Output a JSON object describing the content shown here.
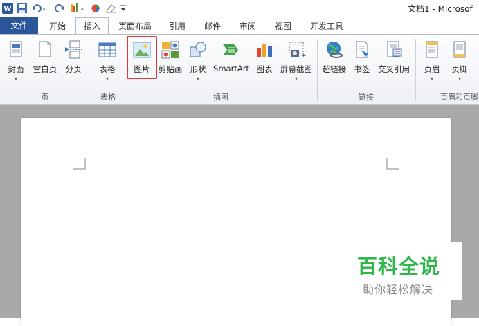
{
  "window": {
    "title": "文档1 - Microsof"
  },
  "quick_access": {
    "icons": [
      "word-logo-icon",
      "save-icon",
      "undo-icon",
      "redo-icon",
      "paint-icon",
      "circle-icon",
      "eraser-icon",
      "customize-icon"
    ]
  },
  "tabs": [
    "文件",
    "开始",
    "插入",
    "页面布局",
    "引用",
    "邮件",
    "审阅",
    "视图",
    "开发工具"
  ],
  "active_tab": "插入",
  "ribbon": {
    "buttons": {
      "cover": "封面",
      "blank": "空白页",
      "break": "分页",
      "table": "表格",
      "picture": "图片",
      "clipart": "剪贴画",
      "shapes": "形状",
      "smartart": "SmartArt",
      "chart": "图表",
      "screenshot": "屏幕截图",
      "hyperlink": "超链接",
      "bookmark": "书签",
      "crossref": "交叉引用",
      "header": "页眉",
      "footer": "页脚"
    },
    "groups": {
      "pages": "页",
      "tables": "表格",
      "illustrations": "插图",
      "links": "链接",
      "header_footer": "页眉和页脚"
    },
    "highlight_color": "#e0393a"
  },
  "watermark": {
    "title": "百科全说",
    "subtitle": "助你轻松解决",
    "title_color": "#2fb84a"
  }
}
